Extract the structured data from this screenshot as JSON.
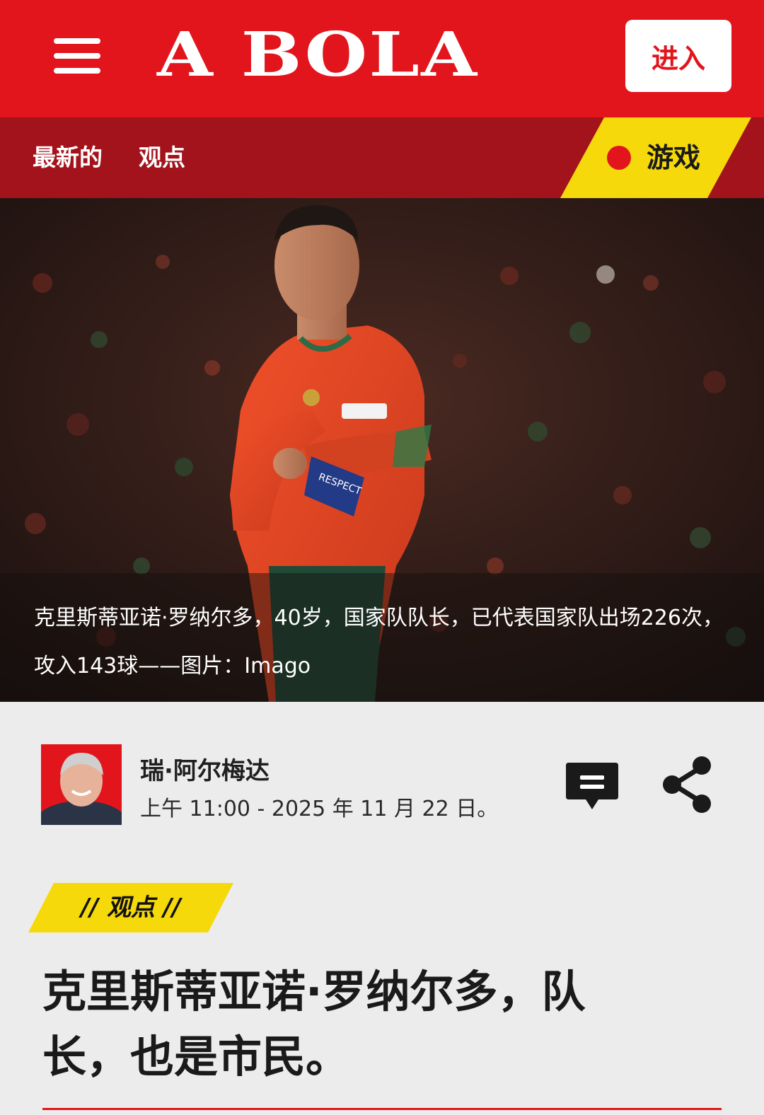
{
  "header": {
    "logo": "A BOLA",
    "enter_label": "进入"
  },
  "subnav": {
    "items": [
      "最新的",
      "观点"
    ],
    "games_label": "游戏"
  },
  "hero": {
    "caption": "克里斯蒂亚诺·罗纳尔多，40岁，国家队队长，已代表国家队出场226次，攻入143球——图片：Imago",
    "armband_text": "RESPECT"
  },
  "author": {
    "name": "瑞·阿尔梅达",
    "date": "上午 11:00 - 2025 年 11 月 22 日。"
  },
  "article": {
    "category": "// 观点 //",
    "headline": "克里斯蒂亚诺·罗纳尔多，队长，也是市民。"
  },
  "colors": {
    "brand_red": "#e2151c",
    "nav_dark_red": "#a3131b",
    "accent_yellow": "#f5d90a"
  }
}
